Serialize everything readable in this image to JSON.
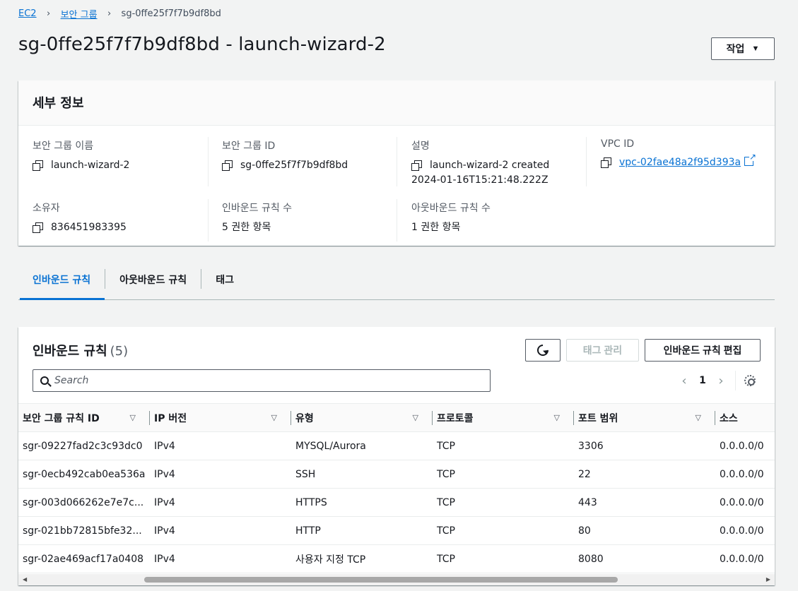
{
  "breadcrumb": {
    "root": "EC2",
    "section": "보안 그룹",
    "current": "sg-0ffe25f7f7b9df8bd"
  },
  "page": {
    "title": "sg-0ffe25f7f7b9df8bd - launch-wizard-2",
    "actions_label": "작업"
  },
  "details": {
    "heading": "세부 정보",
    "sg_name_label": "보안 그룹 이름",
    "sg_name": "launch-wizard-2",
    "sg_id_label": "보안 그룹 ID",
    "sg_id": "sg-0ffe25f7f7b9df8bd",
    "desc_label": "설명",
    "desc_line1": "launch-wizard-2 created",
    "desc_line2": "2024-01-16T15:21:48.222Z",
    "vpc_label": "VPC ID",
    "vpc_id": "vpc-02fae48a2f95d393a",
    "owner_label": "소유자",
    "owner": "836451983395",
    "inbound_count_label": "인바운드 규칙 수",
    "inbound_count": "5 권한 항목",
    "outbound_count_label": "아웃바운드 규칙 수",
    "outbound_count": "1 권한 항목"
  },
  "tabs": [
    "인바운드 규칙",
    "아웃바운드 규칙",
    "태그"
  ],
  "rules": {
    "title": "인바운드 규칙",
    "count": "(5)",
    "manage_tags_label": "태그 관리",
    "edit_label": "인바운드 규칙 편집",
    "search_placeholder": "Search",
    "page_prev": "‹",
    "page_number": "1",
    "page_next": "›",
    "columns": [
      "보안 그룹 규칙 ID",
      "IP 버전",
      "유형",
      "프로토콜",
      "포트 범위",
      "소스"
    ],
    "rows": [
      [
        "sgr-09227fad2c3c93dc0",
        "IPv4",
        "MYSQL/Aurora",
        "TCP",
        "3306",
        "0.0.0.0/0"
      ],
      [
        "sgr-0ecb492cab0ea536a",
        "IPv4",
        "SSH",
        "TCP",
        "22",
        "0.0.0.0/0"
      ],
      [
        "sgr-003d066262e7e7c...",
        "IPv4",
        "HTTPS",
        "TCP",
        "443",
        "0.0.0.0/0"
      ],
      [
        "sgr-021bb72815bfe32...",
        "IPv4",
        "HTTP",
        "TCP",
        "80",
        "0.0.0.0/0"
      ],
      [
        "sgr-02ae469acf17a0408",
        "IPv4",
        "사용자 지정 TCP",
        "TCP",
        "8080",
        "0.0.0.0/0"
      ]
    ]
  }
}
